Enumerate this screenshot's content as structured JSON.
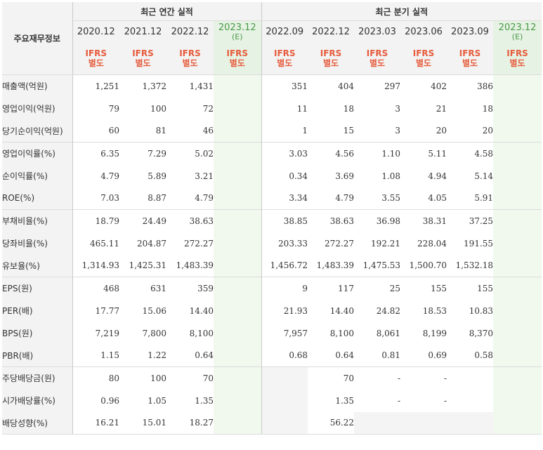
{
  "header": {
    "corner_label": "주요재무정보",
    "annual_group": "최근 연간 실적",
    "quarterly_group": "최근 분기 실적",
    "ifrs_top": "IFRS",
    "ifrs_bottom": "별도",
    "estimate_mark": "(E)"
  },
  "annual_periods": [
    "2020.12",
    "2021.12",
    "2022.12",
    "2023.12"
  ],
  "quarterly_periods": [
    "2022.09",
    "2022.12",
    "2023.03",
    "2023.06",
    "2023.09",
    "2023.12"
  ],
  "rows": [
    {
      "label": "매출액(억원)",
      "annual": [
        "1,251",
        "1,372",
        "1,431",
        ""
      ],
      "quarterly": [
        "351",
        "404",
        "297",
        "402",
        "386",
        ""
      ]
    },
    {
      "label": "영업이익(억원)",
      "annual": [
        "79",
        "100",
        "72",
        ""
      ],
      "quarterly": [
        "11",
        "18",
        "3",
        "21",
        "18",
        ""
      ]
    },
    {
      "label": "당기순이익(억원)",
      "annual": [
        "60",
        "81",
        "46",
        ""
      ],
      "quarterly": [
        "1",
        "15",
        "3",
        "20",
        "20",
        ""
      ]
    },
    {
      "label": "영업이익률(%)",
      "annual": [
        "6.35",
        "7.29",
        "5.02",
        ""
      ],
      "quarterly": [
        "3.03",
        "4.56",
        "1.10",
        "5.11",
        "4.58",
        ""
      ]
    },
    {
      "label": "순이익률(%)",
      "annual": [
        "4.79",
        "5.89",
        "3.21",
        ""
      ],
      "quarterly": [
        "0.34",
        "3.69",
        "1.08",
        "4.94",
        "5.14",
        ""
      ]
    },
    {
      "label": "ROE(%)",
      "annual": [
        "7.03",
        "8.87",
        "4.79",
        ""
      ],
      "quarterly": [
        "3.34",
        "4.79",
        "3.55",
        "4.05",
        "5.91",
        ""
      ]
    },
    {
      "label": "부채비율(%)",
      "annual": [
        "18.79",
        "24.49",
        "38.63",
        ""
      ],
      "quarterly": [
        "38.85",
        "38.63",
        "36.98",
        "38.31",
        "37.25",
        ""
      ]
    },
    {
      "label": "당좌비율(%)",
      "annual": [
        "465.11",
        "204.87",
        "272.27",
        ""
      ],
      "quarterly": [
        "203.33",
        "272.27",
        "192.21",
        "228.04",
        "191.55",
        ""
      ]
    },
    {
      "label": "유보율(%)",
      "annual": [
        "1,314.93",
        "1,425.31",
        "1,483.39",
        ""
      ],
      "quarterly": [
        "1,456.72",
        "1,483.39",
        "1,475.53",
        "1,500.70",
        "1,532.18",
        ""
      ]
    },
    {
      "label": "EPS(원)",
      "annual": [
        "468",
        "631",
        "359",
        ""
      ],
      "quarterly": [
        "9",
        "117",
        "25",
        "155",
        "155",
        ""
      ]
    },
    {
      "label": "PER(배)",
      "annual": [
        "17.77",
        "15.06",
        "14.40",
        ""
      ],
      "quarterly": [
        "21.93",
        "14.40",
        "24.82",
        "18.53",
        "10.83",
        ""
      ]
    },
    {
      "label": "BPS(원)",
      "annual": [
        "7,219",
        "7,800",
        "8,100",
        ""
      ],
      "quarterly": [
        "7,957",
        "8,100",
        "8,061",
        "8,199",
        "8,370",
        ""
      ]
    },
    {
      "label": "PBR(배)",
      "annual": [
        "1.15",
        "1.22",
        "0.64",
        ""
      ],
      "quarterly": [
        "0.68",
        "0.64",
        "0.81",
        "0.69",
        "0.58",
        ""
      ]
    },
    {
      "label": "주당배당금(원)",
      "annual": [
        "80",
        "100",
        "70",
        ""
      ],
      "quarterly": [
        "",
        "70",
        "-",
        "-",
        "",
        ""
      ]
    },
    {
      "label": "시가배당률(%)",
      "annual": [
        "0.96",
        "1.05",
        "1.35",
        ""
      ],
      "quarterly": [
        "",
        "1.35",
        "-",
        "-",
        "",
        ""
      ]
    },
    {
      "label": "배당성향(%)",
      "annual": [
        "16.21",
        "15.01",
        "18.27",
        ""
      ],
      "quarterly": [
        "",
        "56.22",
        "",
        "",
        "",
        ""
      ]
    }
  ]
}
